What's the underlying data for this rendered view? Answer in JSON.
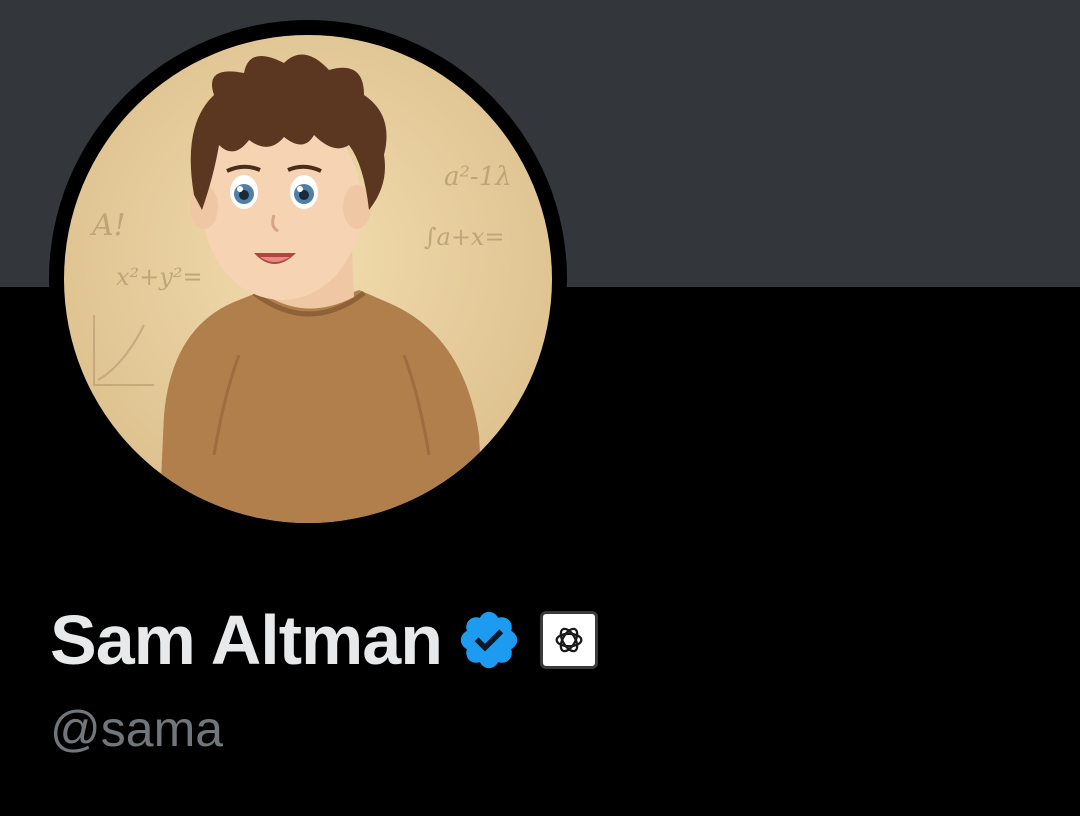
{
  "profile": {
    "display_name": "Sam Altman",
    "handle": "@sama",
    "verified": true,
    "verified_color": "#1d9bf0",
    "affiliate_logo": "openai-logo-icon",
    "avatar_description_icon": "avatar"
  },
  "avatar_scribbles": [
    "A!",
    "x²+y²=",
    "a²-1λ",
    "∫a+x="
  ],
  "theme": {
    "banner_color": "#33363b",
    "background_color": "#000000",
    "name_color": "#e7e9ea",
    "handle_color": "#71767b"
  }
}
